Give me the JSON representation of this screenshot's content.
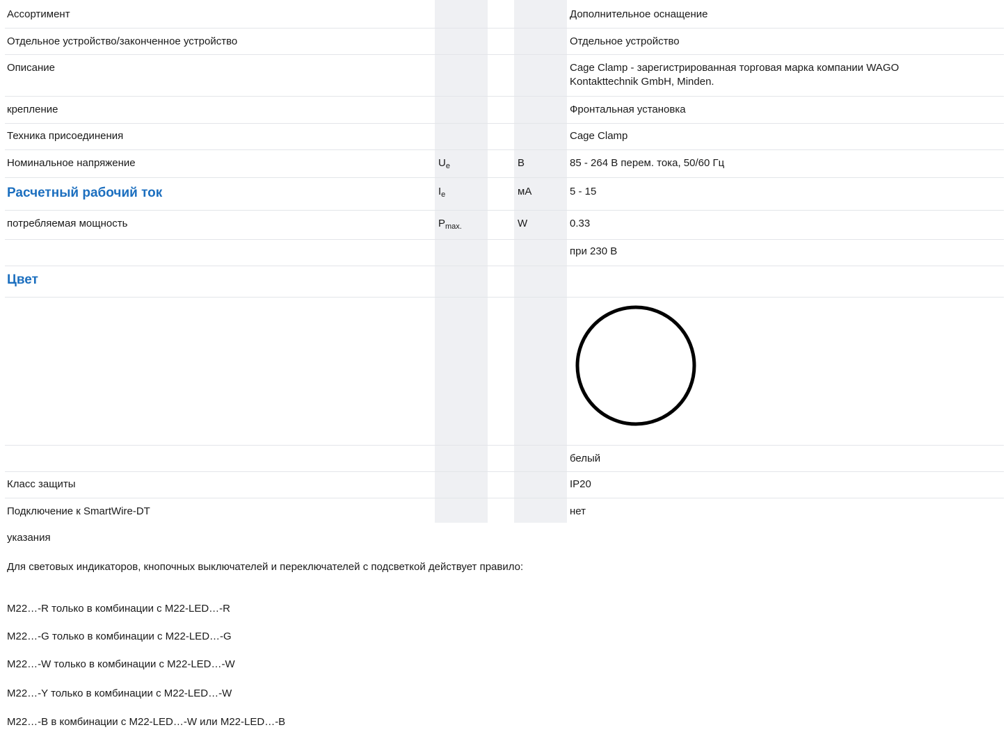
{
  "specs": {
    "assortment": {
      "label": "Ассортимент",
      "value": "Дополнительное оснащение"
    },
    "device": {
      "label": "Отдельное устройство/законченное устройство",
      "value": "Отдельное устройство"
    },
    "description": {
      "label": "Описание",
      "value_line1": "Cage Clamp - зарегистрированная торговая марка компании WAGO",
      "value_line2": "Kontakttechnik GmbH, Minden."
    },
    "mounting": {
      "label": "крепление",
      "value": "Фронтальная установка"
    },
    "connection": {
      "label": "Техника присоединения",
      "value": "Cage Clamp"
    },
    "voltage": {
      "label": "Номинальное напряжение",
      "symbol": "U",
      "symbol_sub": "e",
      "unit": "В",
      "value": "85 - 264 В перем. тока, 50/60 Гц"
    },
    "current": {
      "label": "Расчетный рабочий ток",
      "symbol": "I",
      "symbol_sub": "e",
      "unit": "мА",
      "value": "5 - 15"
    },
    "power": {
      "label": "потребляемая мощность",
      "symbol": "P",
      "symbol_sub": "max.",
      "unit": "W",
      "value": "0.33"
    },
    "power_note": {
      "value": "при 230 В"
    },
    "color": {
      "label": "Цвет",
      "icon": "white-circle-icon",
      "value": "белый",
      "swatch": "#ffffff"
    },
    "protection": {
      "label": "Класс защиты",
      "value": "IP20"
    },
    "smartwire": {
      "label": "Подключение к SmartWire-DT",
      "value": "нет"
    }
  },
  "notes": {
    "heading": "указания",
    "intro": "Для световых индикаторов, кнопочных выключателей и переключателей с подсветкой действует правило:",
    "rules": [
      "M22…-R только в комбинации с M22-LED…-R",
      "M22…-G только в комбинации с M22-LED…-G",
      "M22…-W только в комбинации с M22-LED…-W",
      "M22…-Y только в комбинации с M22-LED…-W",
      "M22…-B в комбинации с M22-LED…-W или M22-LED…-B"
    ]
  },
  "colors": {
    "accent": "#1c6fbf",
    "shade": "#eff0f3",
    "divider": "#e3e5e9"
  }
}
